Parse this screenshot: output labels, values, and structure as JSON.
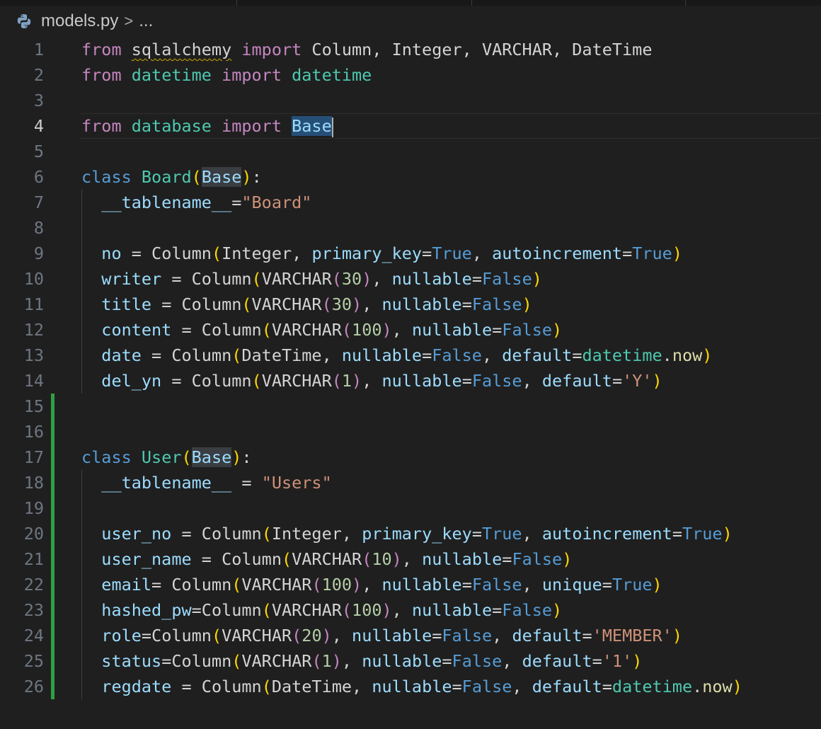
{
  "breadcrumb": {
    "file": "models.py",
    "separator": ">",
    "more": "..."
  },
  "editor": {
    "language": "python",
    "active_line": 4,
    "line_numbers": [
      "1",
      "2",
      "3",
      "4",
      "5",
      "6",
      "7",
      "8",
      "9",
      "10",
      "11",
      "12",
      "13",
      "14",
      "15",
      "16",
      "17",
      "18",
      "19",
      "20",
      "21",
      "22",
      "23",
      "24",
      "25",
      "26"
    ],
    "lines": [
      [
        [
          "kw",
          "from"
        ],
        [
          "pl",
          " "
        ],
        [
          "pl squig",
          "sqlalchemy"
        ],
        [
          "pl",
          " "
        ],
        [
          "kw",
          "import"
        ],
        [
          "pl",
          " Column, Integer, VARCHAR, DateTime"
        ]
      ],
      [
        [
          "kw",
          "from"
        ],
        [
          "pl",
          " "
        ],
        [
          "cls",
          "datetime"
        ],
        [
          "pl",
          " "
        ],
        [
          "kw",
          "import"
        ],
        [
          "pl",
          " "
        ],
        [
          "cls",
          "datetime"
        ]
      ],
      [],
      [
        [
          "kw",
          "from"
        ],
        [
          "pl",
          " "
        ],
        [
          "cls",
          "database"
        ],
        [
          "pl",
          " "
        ],
        [
          "kw",
          "import"
        ],
        [
          "pl",
          " "
        ],
        [
          "var sel",
          "Base"
        ],
        [
          "caret",
          ""
        ]
      ],
      [],
      [
        [
          "kwb",
          "class"
        ],
        [
          "pl",
          " "
        ],
        [
          "cls",
          "Board"
        ],
        [
          "br",
          "("
        ],
        [
          "var hl",
          "Base"
        ],
        [
          "br",
          ")"
        ],
        [
          "pl",
          ":"
        ]
      ],
      [
        [
          "pl",
          "  "
        ],
        [
          "var",
          "__tablename__"
        ],
        [
          "op",
          "="
        ],
        [
          "str",
          "\"Board\""
        ]
      ],
      [],
      [
        [
          "pl",
          "  "
        ],
        [
          "var",
          "no"
        ],
        [
          "op",
          " = "
        ],
        [
          "pl",
          "Column"
        ],
        [
          "br",
          "("
        ],
        [
          "pl",
          "Integer, "
        ],
        [
          "var",
          "primary_key"
        ],
        [
          "op",
          "="
        ],
        [
          "kwb",
          "True"
        ],
        [
          "pl",
          ", "
        ],
        [
          "var",
          "autoincrement"
        ],
        [
          "op",
          "="
        ],
        [
          "kwb",
          "True"
        ],
        [
          "br",
          ")"
        ]
      ],
      [
        [
          "pl",
          "  "
        ],
        [
          "var",
          "writer"
        ],
        [
          "op",
          " = "
        ],
        [
          "pl",
          "Column"
        ],
        [
          "br",
          "("
        ],
        [
          "pl",
          "VARCHAR"
        ],
        [
          "kw",
          "("
        ],
        [
          "num",
          "30"
        ],
        [
          "kw",
          ")"
        ],
        [
          "pl",
          ", "
        ],
        [
          "var",
          "nullable"
        ],
        [
          "op",
          "="
        ],
        [
          "kwb",
          "False"
        ],
        [
          "br",
          ")"
        ]
      ],
      [
        [
          "pl",
          "  "
        ],
        [
          "var",
          "title"
        ],
        [
          "op",
          " = "
        ],
        [
          "pl",
          "Column"
        ],
        [
          "br",
          "("
        ],
        [
          "pl",
          "VARCHAR"
        ],
        [
          "kw",
          "("
        ],
        [
          "num",
          "30"
        ],
        [
          "kw",
          ")"
        ],
        [
          "pl",
          ", "
        ],
        [
          "var",
          "nullable"
        ],
        [
          "op",
          "="
        ],
        [
          "kwb",
          "False"
        ],
        [
          "br",
          ")"
        ]
      ],
      [
        [
          "pl",
          "  "
        ],
        [
          "var",
          "content"
        ],
        [
          "op",
          " = "
        ],
        [
          "pl",
          "Column"
        ],
        [
          "br",
          "("
        ],
        [
          "pl",
          "VARCHAR"
        ],
        [
          "kw",
          "("
        ],
        [
          "num",
          "100"
        ],
        [
          "kw",
          ")"
        ],
        [
          "pl",
          ", "
        ],
        [
          "var",
          "nullable"
        ],
        [
          "op",
          "="
        ],
        [
          "kwb",
          "False"
        ],
        [
          "br",
          ")"
        ]
      ],
      [
        [
          "pl",
          "  "
        ],
        [
          "var",
          "date"
        ],
        [
          "op",
          " = "
        ],
        [
          "pl",
          "Column"
        ],
        [
          "br",
          "("
        ],
        [
          "pl",
          "DateTime, "
        ],
        [
          "var",
          "nullable"
        ],
        [
          "op",
          "="
        ],
        [
          "kwb",
          "False"
        ],
        [
          "pl",
          ", "
        ],
        [
          "var",
          "default"
        ],
        [
          "op",
          "="
        ],
        [
          "cls",
          "datetime"
        ],
        [
          "pl",
          "."
        ],
        [
          "fn",
          "now"
        ],
        [
          "br",
          ")"
        ]
      ],
      [
        [
          "pl",
          "  "
        ],
        [
          "var",
          "del_yn"
        ],
        [
          "op",
          " = "
        ],
        [
          "pl",
          "Column"
        ],
        [
          "br",
          "("
        ],
        [
          "pl",
          "VARCHAR"
        ],
        [
          "kw",
          "("
        ],
        [
          "num",
          "1"
        ],
        [
          "kw",
          ")"
        ],
        [
          "pl",
          ", "
        ],
        [
          "var",
          "nullable"
        ],
        [
          "op",
          "="
        ],
        [
          "kwb",
          "False"
        ],
        [
          "pl",
          ", "
        ],
        [
          "var",
          "default"
        ],
        [
          "op",
          "="
        ],
        [
          "str",
          "'Y'"
        ],
        [
          "br",
          ")"
        ]
      ],
      [],
      [],
      [
        [
          "kwb",
          "class"
        ],
        [
          "pl",
          " "
        ],
        [
          "cls",
          "User"
        ],
        [
          "br",
          "("
        ],
        [
          "var hl",
          "Base"
        ],
        [
          "br",
          ")"
        ],
        [
          "pl",
          ":"
        ]
      ],
      [
        [
          "pl",
          "  "
        ],
        [
          "var",
          "__tablename__"
        ],
        [
          "op",
          " = "
        ],
        [
          "str",
          "\"Users\""
        ]
      ],
      [],
      [
        [
          "pl",
          "  "
        ],
        [
          "var",
          "user_no"
        ],
        [
          "op",
          " = "
        ],
        [
          "pl",
          "Column"
        ],
        [
          "br",
          "("
        ],
        [
          "pl",
          "Integer, "
        ],
        [
          "var",
          "primary_key"
        ],
        [
          "op",
          "="
        ],
        [
          "kwb",
          "True"
        ],
        [
          "pl",
          ", "
        ],
        [
          "var",
          "autoincrement"
        ],
        [
          "op",
          "="
        ],
        [
          "kwb",
          "True"
        ],
        [
          "br",
          ")"
        ]
      ],
      [
        [
          "pl",
          "  "
        ],
        [
          "var",
          "user_name"
        ],
        [
          "op",
          " = "
        ],
        [
          "pl",
          "Column"
        ],
        [
          "br",
          "("
        ],
        [
          "pl",
          "VARCHAR"
        ],
        [
          "kw",
          "("
        ],
        [
          "num",
          "10"
        ],
        [
          "kw",
          ")"
        ],
        [
          "pl",
          ", "
        ],
        [
          "var",
          "nullable"
        ],
        [
          "op",
          "="
        ],
        [
          "kwb",
          "False"
        ],
        [
          "br",
          ")"
        ]
      ],
      [
        [
          "pl",
          "  "
        ],
        [
          "var",
          "email"
        ],
        [
          "op",
          "= "
        ],
        [
          "pl",
          "Column"
        ],
        [
          "br",
          "("
        ],
        [
          "pl",
          "VARCHAR"
        ],
        [
          "kw",
          "("
        ],
        [
          "num",
          "100"
        ],
        [
          "kw",
          ")"
        ],
        [
          "pl",
          ", "
        ],
        [
          "var",
          "nullable"
        ],
        [
          "op",
          "="
        ],
        [
          "kwb",
          "False"
        ],
        [
          "pl",
          ", "
        ],
        [
          "var",
          "unique"
        ],
        [
          "op",
          "="
        ],
        [
          "kwb",
          "True"
        ],
        [
          "br",
          ")"
        ]
      ],
      [
        [
          "pl",
          "  "
        ],
        [
          "var",
          "hashed_pw"
        ],
        [
          "op",
          "="
        ],
        [
          "pl",
          "Column"
        ],
        [
          "br",
          "("
        ],
        [
          "pl",
          "VARCHAR"
        ],
        [
          "kw",
          "("
        ],
        [
          "num",
          "100"
        ],
        [
          "kw",
          ")"
        ],
        [
          "pl",
          ", "
        ],
        [
          "var",
          "nullable"
        ],
        [
          "op",
          "="
        ],
        [
          "kwb",
          "False"
        ],
        [
          "br",
          ")"
        ]
      ],
      [
        [
          "pl",
          "  "
        ],
        [
          "var",
          "role"
        ],
        [
          "op",
          "="
        ],
        [
          "pl",
          "Column"
        ],
        [
          "br",
          "("
        ],
        [
          "pl",
          "VARCHAR"
        ],
        [
          "kw",
          "("
        ],
        [
          "num",
          "20"
        ],
        [
          "kw",
          ")"
        ],
        [
          "pl",
          ", "
        ],
        [
          "var",
          "nullable"
        ],
        [
          "op",
          "="
        ],
        [
          "kwb",
          "False"
        ],
        [
          "pl",
          ", "
        ],
        [
          "var",
          "default"
        ],
        [
          "op",
          "="
        ],
        [
          "str",
          "'MEMBER'"
        ],
        [
          "br",
          ")"
        ]
      ],
      [
        [
          "pl",
          "  "
        ],
        [
          "var",
          "status"
        ],
        [
          "op",
          "="
        ],
        [
          "pl",
          "Column"
        ],
        [
          "br",
          "("
        ],
        [
          "pl",
          "VARCHAR"
        ],
        [
          "kw",
          "("
        ],
        [
          "num",
          "1"
        ],
        [
          "kw",
          ")"
        ],
        [
          "pl",
          ", "
        ],
        [
          "var",
          "nullable"
        ],
        [
          "op",
          "="
        ],
        [
          "kwb",
          "False"
        ],
        [
          "pl",
          ", "
        ],
        [
          "var",
          "default"
        ],
        [
          "op",
          "="
        ],
        [
          "str",
          "'1'"
        ],
        [
          "br",
          ")"
        ]
      ],
      [
        [
          "pl",
          "  "
        ],
        [
          "var",
          "regdate"
        ],
        [
          "op",
          " = "
        ],
        [
          "pl",
          "Column"
        ],
        [
          "br",
          "("
        ],
        [
          "pl",
          "DateTime, "
        ],
        [
          "var",
          "nullable"
        ],
        [
          "op",
          "="
        ],
        [
          "kwb",
          "False"
        ],
        [
          "pl",
          ", "
        ],
        [
          "var",
          "default"
        ],
        [
          "op",
          "="
        ],
        [
          "cls",
          "datetime"
        ],
        [
          "pl",
          "."
        ],
        [
          "fn",
          "now"
        ],
        [
          "br",
          ")"
        ]
      ]
    ],
    "git_added_lines": [
      15,
      16,
      17,
      18,
      19,
      20,
      21,
      22,
      23,
      24,
      25,
      26
    ],
    "indented_lines": [
      7,
      8,
      9,
      10,
      11,
      12,
      13,
      14,
      18,
      19,
      20,
      21,
      22,
      23,
      24,
      25,
      26
    ]
  },
  "colors": {
    "background": "#1f1f1f",
    "keyword": "#c586c0",
    "builtin_keyword": "#569cd6",
    "class_name": "#4ec9b0",
    "variable": "#9cdcfe",
    "string": "#ce9178",
    "number": "#b5cea8",
    "bracket": "#ffd700",
    "git_added": "#2ea043"
  },
  "icons": {
    "file_icon": "python-icon"
  }
}
